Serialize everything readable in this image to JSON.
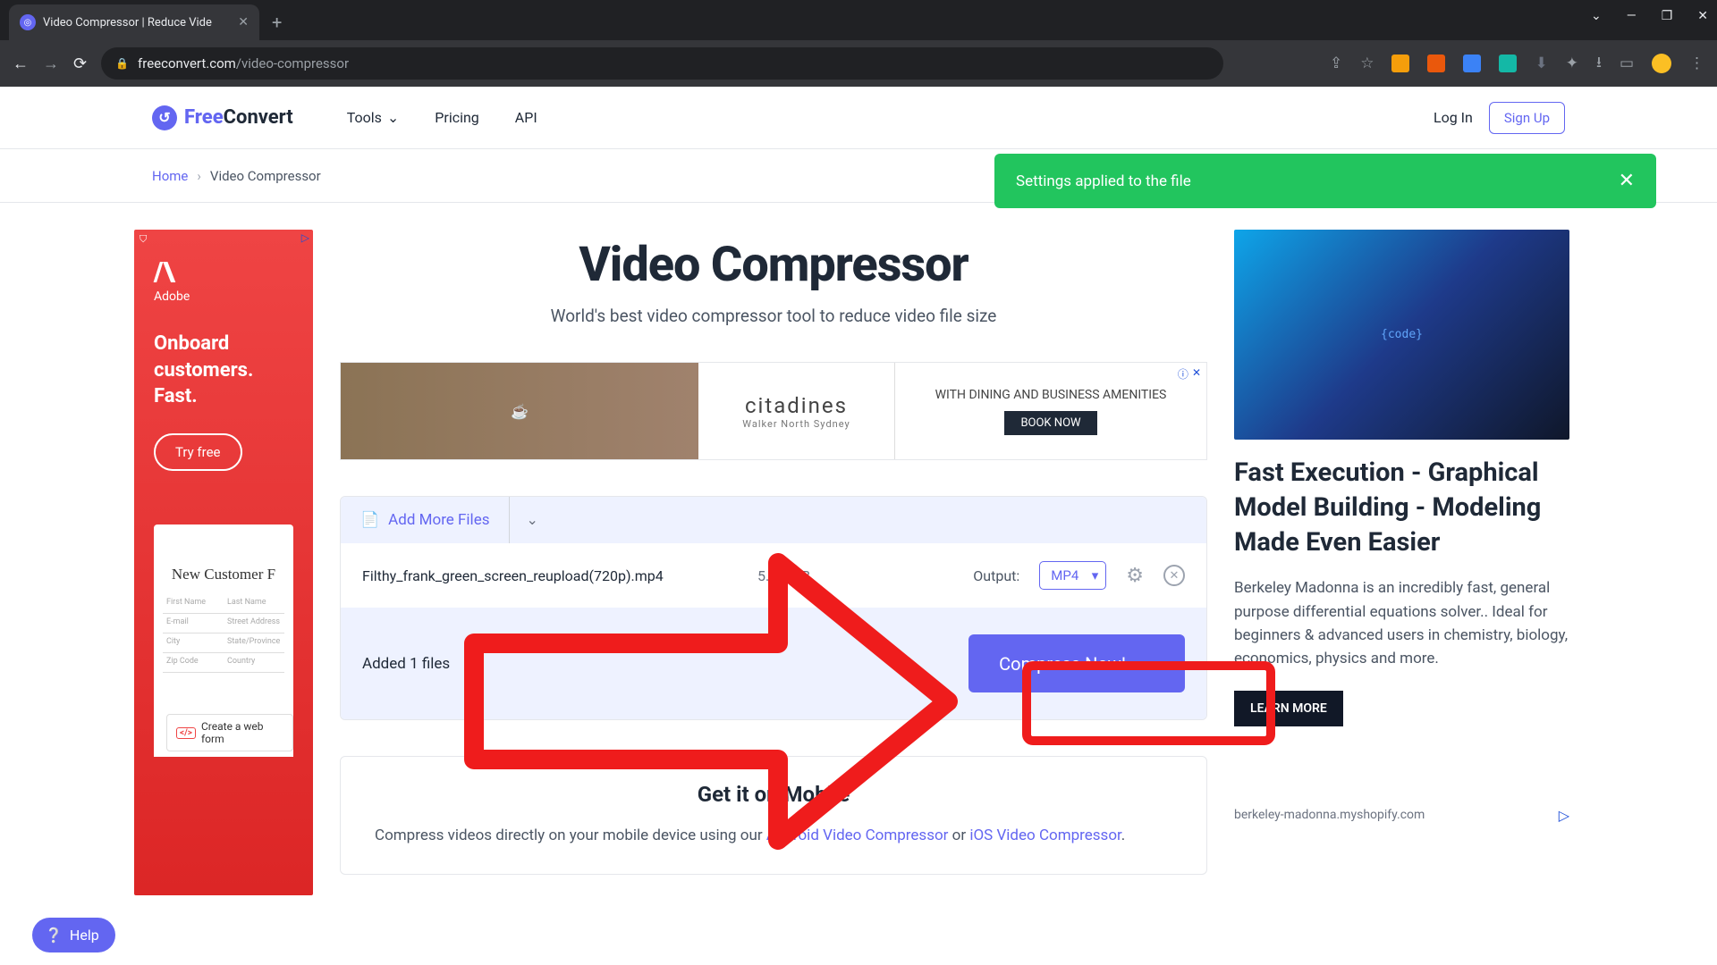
{
  "browser": {
    "tab_title": "Video Compressor | Reduce Vide",
    "url_host": "freeconvert.com",
    "url_path": "/video-compressor"
  },
  "header": {
    "logo_free": "Free",
    "logo_convert": "Convert",
    "nav": {
      "tools": "Tools",
      "pricing": "Pricing",
      "api": "API"
    },
    "login": "Log In",
    "signup": "Sign Up"
  },
  "breadcrumb": {
    "home": "Home",
    "current": "Video Compressor"
  },
  "toast": {
    "message": "Settings applied to the file"
  },
  "page": {
    "title": "Video Compressor",
    "subtitle": "World's best video compressor tool to reduce video file size"
  },
  "inline_ad": {
    "brand": "citadines",
    "brand_sub": "Walker North Sydney",
    "headline": "WITH DINING AND BUSINESS AMENITIES",
    "cta": "BOOK NOW"
  },
  "left_ad": {
    "brand": "Adobe",
    "headline": "Onboard customers. Fast.",
    "cta": "Try free",
    "form_title": "New Customer F",
    "badge": "Create a web form",
    "fields": [
      "First Name",
      "Last Name",
      "E-mail",
      "Street Address",
      "City",
      "State/Province",
      "Zip Code",
      "Country"
    ]
  },
  "files": {
    "add_more": "Add More Files",
    "row": {
      "name": "Filthy_frank_green_screen_reupload(720p).mp4",
      "size": "5.86 MB",
      "output_label": "Output:",
      "output_value": "MP4"
    },
    "added_text": "Added 1 files",
    "compress": "Compress Now!"
  },
  "mobile": {
    "title": "Get it on Mobile",
    "text_a": "Compress videos directly on your mobile device using our ",
    "link_a": "Android Video Compressor",
    "text_b": " or ",
    "link_b": "iOS Video Compressor",
    "text_c": "."
  },
  "right_ad": {
    "title": "Fast Execution - Graphical Model Building - Modeling Made Even Easier",
    "body": "Berkeley Madonna is an incredibly fast, general purpose differential equations solver.. Ideal for beginners & advanced users in chemistry, biology, economics, physics and more.",
    "cta": "LEARN MORE",
    "url": "berkeley-madonna.myshopify.com"
  },
  "help": {
    "label": "Help"
  }
}
